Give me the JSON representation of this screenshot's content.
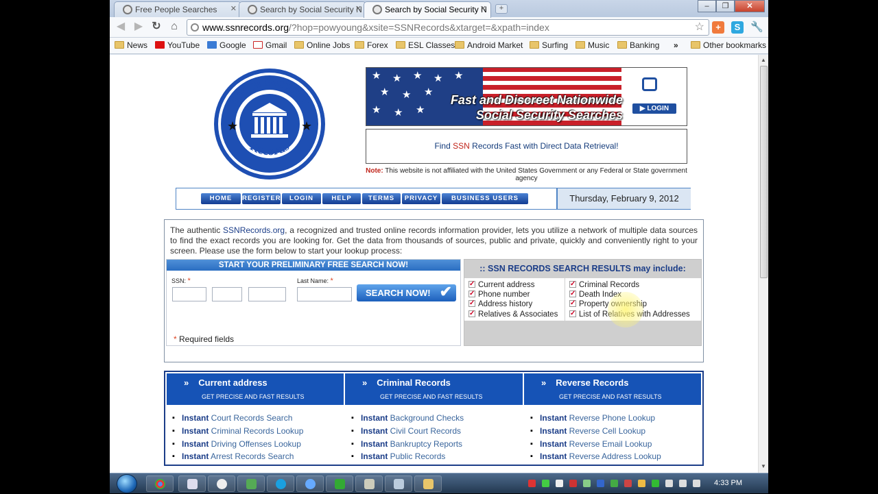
{
  "browser": {
    "tabs": [
      {
        "label": "Free People Searches",
        "active": false
      },
      {
        "label": "Search by Social Security N",
        "active": false
      },
      {
        "label": "Search by Social Security N",
        "active": true
      }
    ],
    "url_host": "www.ssnrecords.org",
    "url_rest": "/?hop=powyoung&xsite=SSNRecords&xtarget=&xpath=index",
    "bookmarks": [
      "News",
      "YouTube",
      "Google",
      "Gmail",
      "Online Jobs",
      "Forex",
      "ESL Classes",
      "Android Market",
      "Surfing",
      "Music",
      "Banking"
    ],
    "bookmarks_more": "»",
    "other_bookmarks": "Other bookmarks"
  },
  "logo": {
    "top_text": "Social Security",
    "bottom_text": "Records"
  },
  "banner": {
    "line1": "Fast and Discreet Nationwide",
    "line2": "Social Security Searches",
    "login_badge": "▶ LOGIN"
  },
  "find": {
    "pre": "Find ",
    "ssn": "SSN",
    "post": " Records Fast with Direct Data Retrieval!"
  },
  "note": {
    "label": "Note:",
    "text": " This website is not affiliated with the United States Government or any Federal or State government agency"
  },
  "nav": {
    "items": [
      "HOME",
      "REGISTER",
      "LOGIN",
      "HELP",
      "TERMS",
      "PRIVACY",
      "BUSINESS USERS"
    ],
    "date": "Thursday, February 9, 2012"
  },
  "intro": {
    "pre": "The authentic ",
    "site": "SSNRecords.org",
    "text": ", a recognized and trusted online records information provider, lets you utilize a network of multiple data sources to find the exact records you are looking for. Get the data from thousands of sources, public and private, quickly and conveniently right to your screen. Please use the form below to start your lookup process:"
  },
  "search_form": {
    "heading": "START YOUR PRELIMINARY FREE SEARCH NOW!",
    "ssn_label": "SSN:",
    "lastname_label": "Last Name:",
    "required_mark": "*",
    "button": "SEARCH NOW!",
    "required_note": " Required fields",
    "ssn_part1": "",
    "ssn_part2": "",
    "ssn_part3": "",
    "last_name": ""
  },
  "results": {
    "heading": ":: SSN RECORDS SEARCH RESULTS may include:",
    "col1": [
      "Current address",
      "Phone number",
      "Address history",
      "Relatives & Associates"
    ],
    "col2": [
      "Criminal Records",
      "Death Index",
      "Property ownership",
      "List of Relatives with Addresses"
    ]
  },
  "categories": [
    {
      "title": "Current address",
      "subtitle": "GET PRECISE AND FAST RESULTS",
      "links": [
        {
          "bold": "Instant",
          "text": " Court Records Search"
        },
        {
          "bold": "Instant",
          "text": " Criminal Records Lookup"
        },
        {
          "bold": "Instant",
          "text": " Driving Offenses Lookup"
        },
        {
          "bold": "Instant",
          "text": " Arrest Records Search"
        }
      ]
    },
    {
      "title": "Criminal Records",
      "subtitle": "GET PRECISE AND FAST RESULTS",
      "links": [
        {
          "bold": "Instant",
          "text": " Background Checks"
        },
        {
          "bold": "Instant",
          "text": " Civil Court Records"
        },
        {
          "bold": "Instant",
          "text": " Bankruptcy Reports"
        },
        {
          "bold": "Instant",
          "text": " Public Records"
        }
      ]
    },
    {
      "title": "Reverse Records",
      "subtitle": "GET PRECISE AND FAST RESULTS",
      "links": [
        {
          "bold": "Instant",
          "text": " Reverse Phone Lookup"
        },
        {
          "bold": "Instant",
          "text": " Reverse Cell Lookup"
        },
        {
          "bold": "Instant",
          "text": " Reverse Email Lookup"
        },
        {
          "bold": "Instant",
          "text": " Reverse Address Lookup"
        }
      ]
    }
  ],
  "taskbar": {
    "clock": "4:33 PM"
  },
  "colors": {
    "nav_blue": "#1653b6",
    "link_blue": "#1b3d88",
    "alert_red": "#c0241a"
  }
}
